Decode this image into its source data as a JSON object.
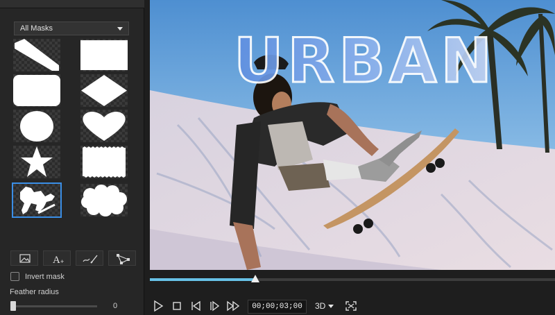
{
  "mask_panel": {
    "dropdown": {
      "selected": "All Masks",
      "icon": "chevron-down-icon"
    },
    "masks": [
      {
        "name": "diagonal-stripe-mask",
        "icon": "diagonal-band-shape"
      },
      {
        "name": "rectangle-mask",
        "icon": "rectangle-shape"
      },
      {
        "name": "rounded-rectangle-mask",
        "icon": "rounded-rectangle-shape"
      },
      {
        "name": "diamond-mask",
        "icon": "diamond-shape"
      },
      {
        "name": "circle-mask",
        "icon": "circle-shape"
      },
      {
        "name": "heart-mask",
        "icon": "heart-shape"
      },
      {
        "name": "star-mask",
        "icon": "star-shape"
      },
      {
        "name": "stamp-mask",
        "icon": "stamp-edge-shape"
      },
      {
        "name": "skater-silhouette-mask",
        "icon": "skater-silhouette-shape",
        "selected": true
      },
      {
        "name": "cloud-mask",
        "icon": "cloud-shape"
      }
    ],
    "tools": [
      "image-mask-icon",
      "text-mask-icon",
      "brush-mask-icon",
      "path-mask-icon"
    ],
    "invert_mask_label": "Invert mask",
    "invert_mask_checked": false,
    "feather_radius_label": "Feather radius",
    "feather_radius_value": "0"
  },
  "preview": {
    "title_text": "URBAN"
  },
  "timeline": {
    "progress": 0.26,
    "timecode": "00;00;03;00",
    "mode": "3D"
  },
  "colors": {
    "accent": "#67c1e6",
    "selection": "#3a8ee6",
    "panel": "#262626"
  }
}
